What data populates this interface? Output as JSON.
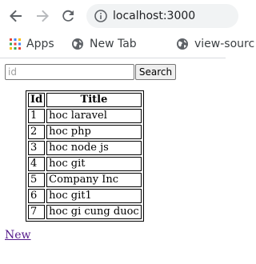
{
  "browser": {
    "url": "localhost:3000",
    "bookmarks": [
      {
        "label": "Apps",
        "icon": "apps-grid-icon"
      },
      {
        "label": "New Tab",
        "icon": "globe-icon"
      },
      {
        "label": "view-sourc",
        "icon": "globe-icon"
      }
    ]
  },
  "search": {
    "placeholder": "id",
    "value": "",
    "button_label": "Search"
  },
  "table": {
    "headers": [
      "Id",
      "Title"
    ],
    "rows": [
      [
        "1",
        "hoc laravel"
      ],
      [
        "2",
        "hoc php"
      ],
      [
        "3",
        "hoc node js"
      ],
      [
        "4",
        "hoc git"
      ],
      [
        "5",
        "Company Inc"
      ],
      [
        "6",
        "hoc git1"
      ],
      [
        "7",
        "hoc gi cung duoc"
      ]
    ]
  },
  "new_link": "New",
  "colors": {
    "link_visited": "#551a8b",
    "chrome_icon": "#5f6368",
    "omnibox_bg": "#f1f3f4"
  }
}
